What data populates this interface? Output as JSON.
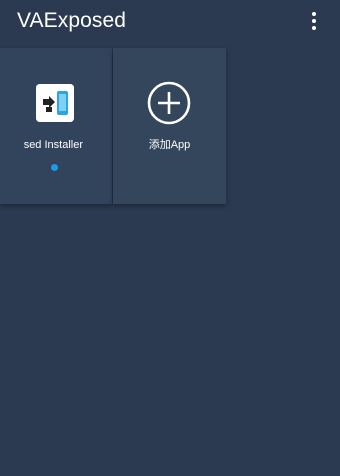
{
  "app_bar": {
    "title": "VAExposed",
    "overflow_icon": "more-vert-icon"
  },
  "apps": [
    {
      "label": "sed Installer",
      "icon": "xposed-installer-icon",
      "status_dot": true,
      "status_color": "#1e9be8"
    }
  ],
  "add_app": {
    "label": "添加App",
    "icon": "add-circle-icon"
  },
  "colors": {
    "background": "#2b3a50",
    "card": "#33465c",
    "accent": "#1e9be8"
  }
}
